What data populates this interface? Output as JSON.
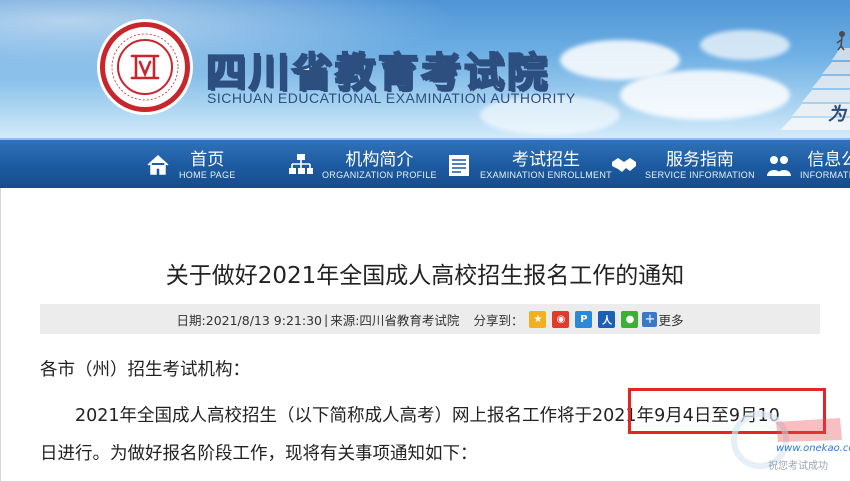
{
  "site": {
    "title": "四川省教育考试院",
    "subtitle": "SICHUAN EDUCATIONAL EXAMINATION AUTHORITY",
    "slogan": "为"
  },
  "nav": {
    "items": [
      {
        "cn": "首页",
        "en": "HOME PAGE",
        "icon": "home-icon"
      },
      {
        "cn": "机构简介",
        "en": "ORGANIZATION PROFILE",
        "icon": "org-chart-icon"
      },
      {
        "cn": "考试招生",
        "en": "EXAMINATION ENROLLMENT",
        "icon": "document-list-icon"
      },
      {
        "cn": "服务指南",
        "en": "SERVICE INFORMATION",
        "icon": "handshake-icon"
      },
      {
        "cn": "信息公",
        "en": "INFORMATION",
        "icon": "people-icon"
      }
    ]
  },
  "article": {
    "title": "关于做好2021年全国成人高校招生报名工作的通知",
    "meta": {
      "date": "日期:2021/8/13 9:21:30",
      "separator": "|",
      "source": "来源:四川省教育考试院",
      "share_label": "分享到：",
      "more_label": "更多"
    },
    "salutation": "各市（州）招生考试机构：",
    "body_line1": "2021年全国成人高校招生（以下简称成人高考）网上报名工作将于2021年9月4日至9月10",
    "body_line2": "日进行。为做好报名阶段工作，现将有关事项通知如下："
  },
  "share_icons": [
    {
      "name": "qzone-share-icon",
      "color": "#f2b01e"
    },
    {
      "name": "weibo-share-icon",
      "color": "#e23b2e"
    },
    {
      "name": "tencent-weibo-share-icon",
      "color": "#2b8ad8"
    },
    {
      "name": "renren-share-icon",
      "color": "#1c5fb6"
    },
    {
      "name": "wechat-share-icon",
      "color": "#3cb034"
    }
  ],
  "watermark": {
    "url": "www.onekao.com",
    "slogan": "祝您考试成功"
  },
  "colors": {
    "nav_bg": "#1c5aa0",
    "highlight_box": "#e52424",
    "seal_red": "#c9252c"
  }
}
